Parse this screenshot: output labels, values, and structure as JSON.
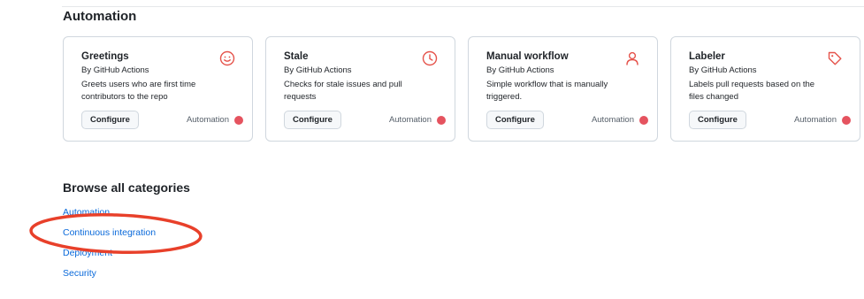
{
  "section": {
    "title": "Automation"
  },
  "cards": [
    {
      "title": "Greetings",
      "by": "By GitHub Actions",
      "description": "Greets users who are first time contributors to the repo",
      "button": "Configure",
      "category": "Automation",
      "icon": "smiley-icon"
    },
    {
      "title": "Stale",
      "by": "By GitHub Actions",
      "description": "Checks for stale issues and pull requests",
      "button": "Configure",
      "category": "Automation",
      "icon": "clock-icon"
    },
    {
      "title": "Manual workflow",
      "by": "By GitHub Actions",
      "description": "Simple workflow that is manually triggered.",
      "button": "Configure",
      "category": "Automation",
      "icon": "person-icon"
    },
    {
      "title": "Labeler",
      "by": "By GitHub Actions",
      "description": "Labels pull requests based on the files changed",
      "button": "Configure",
      "category": "Automation",
      "icon": "tag-icon"
    }
  ],
  "browse": {
    "title": "Browse all categories",
    "links": [
      "Automation",
      "Continuous integration",
      "Deployment",
      "Security"
    ]
  },
  "colors": {
    "accent_icon": "#e5534b",
    "category_dot": "#e5535f",
    "link": "#0969da",
    "annotation": "#e8402a"
  }
}
